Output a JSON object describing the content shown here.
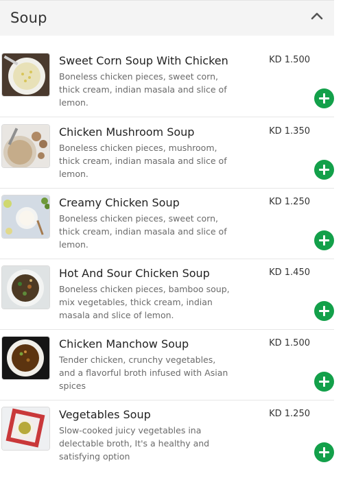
{
  "section": {
    "title": "Soup",
    "collapse_icon": "chevron-up-icon"
  },
  "items": [
    {
      "name": "Sweet Corn Soup With Chicken",
      "description": "Boneless chicken pieces, sweet corn, thick cream, indian masala and slice of lemon.",
      "price": "KD 1.500"
    },
    {
      "name": "Chicken Mushroom Soup",
      "description": "Boneless chicken pieces, mushroom, thick cream, indian masala and slice of lemon.",
      "price": "KD 1.350"
    },
    {
      "name": "Creamy Chicken Soup",
      "description": "Boneless chicken pieces, sweet corn, thick cream, indian masala and slice of lemon.",
      "price": "KD 1.250"
    },
    {
      "name": "Hot And Sour Chicken Soup",
      "description": "Boneless chicken pieces, bamboo soup, mix vegetables, thick cream, indian masala and slice of lemon.",
      "price": "KD 1.450"
    },
    {
      "name": "Chicken Manchow Soup",
      "description": "Tender chicken, crunchy vegetables, and a flavorful broth infused with Asian spices",
      "price": "KD 1.500"
    },
    {
      "name": "Vegetables Soup",
      "description": "Slow-cooked juicy vegetables ina delectable broth, It's a healthy and satisfying option",
      "price": "KD 1.250"
    }
  ],
  "colors": {
    "accent": "#13a04a",
    "header_bg": "#f4f4f4"
  }
}
